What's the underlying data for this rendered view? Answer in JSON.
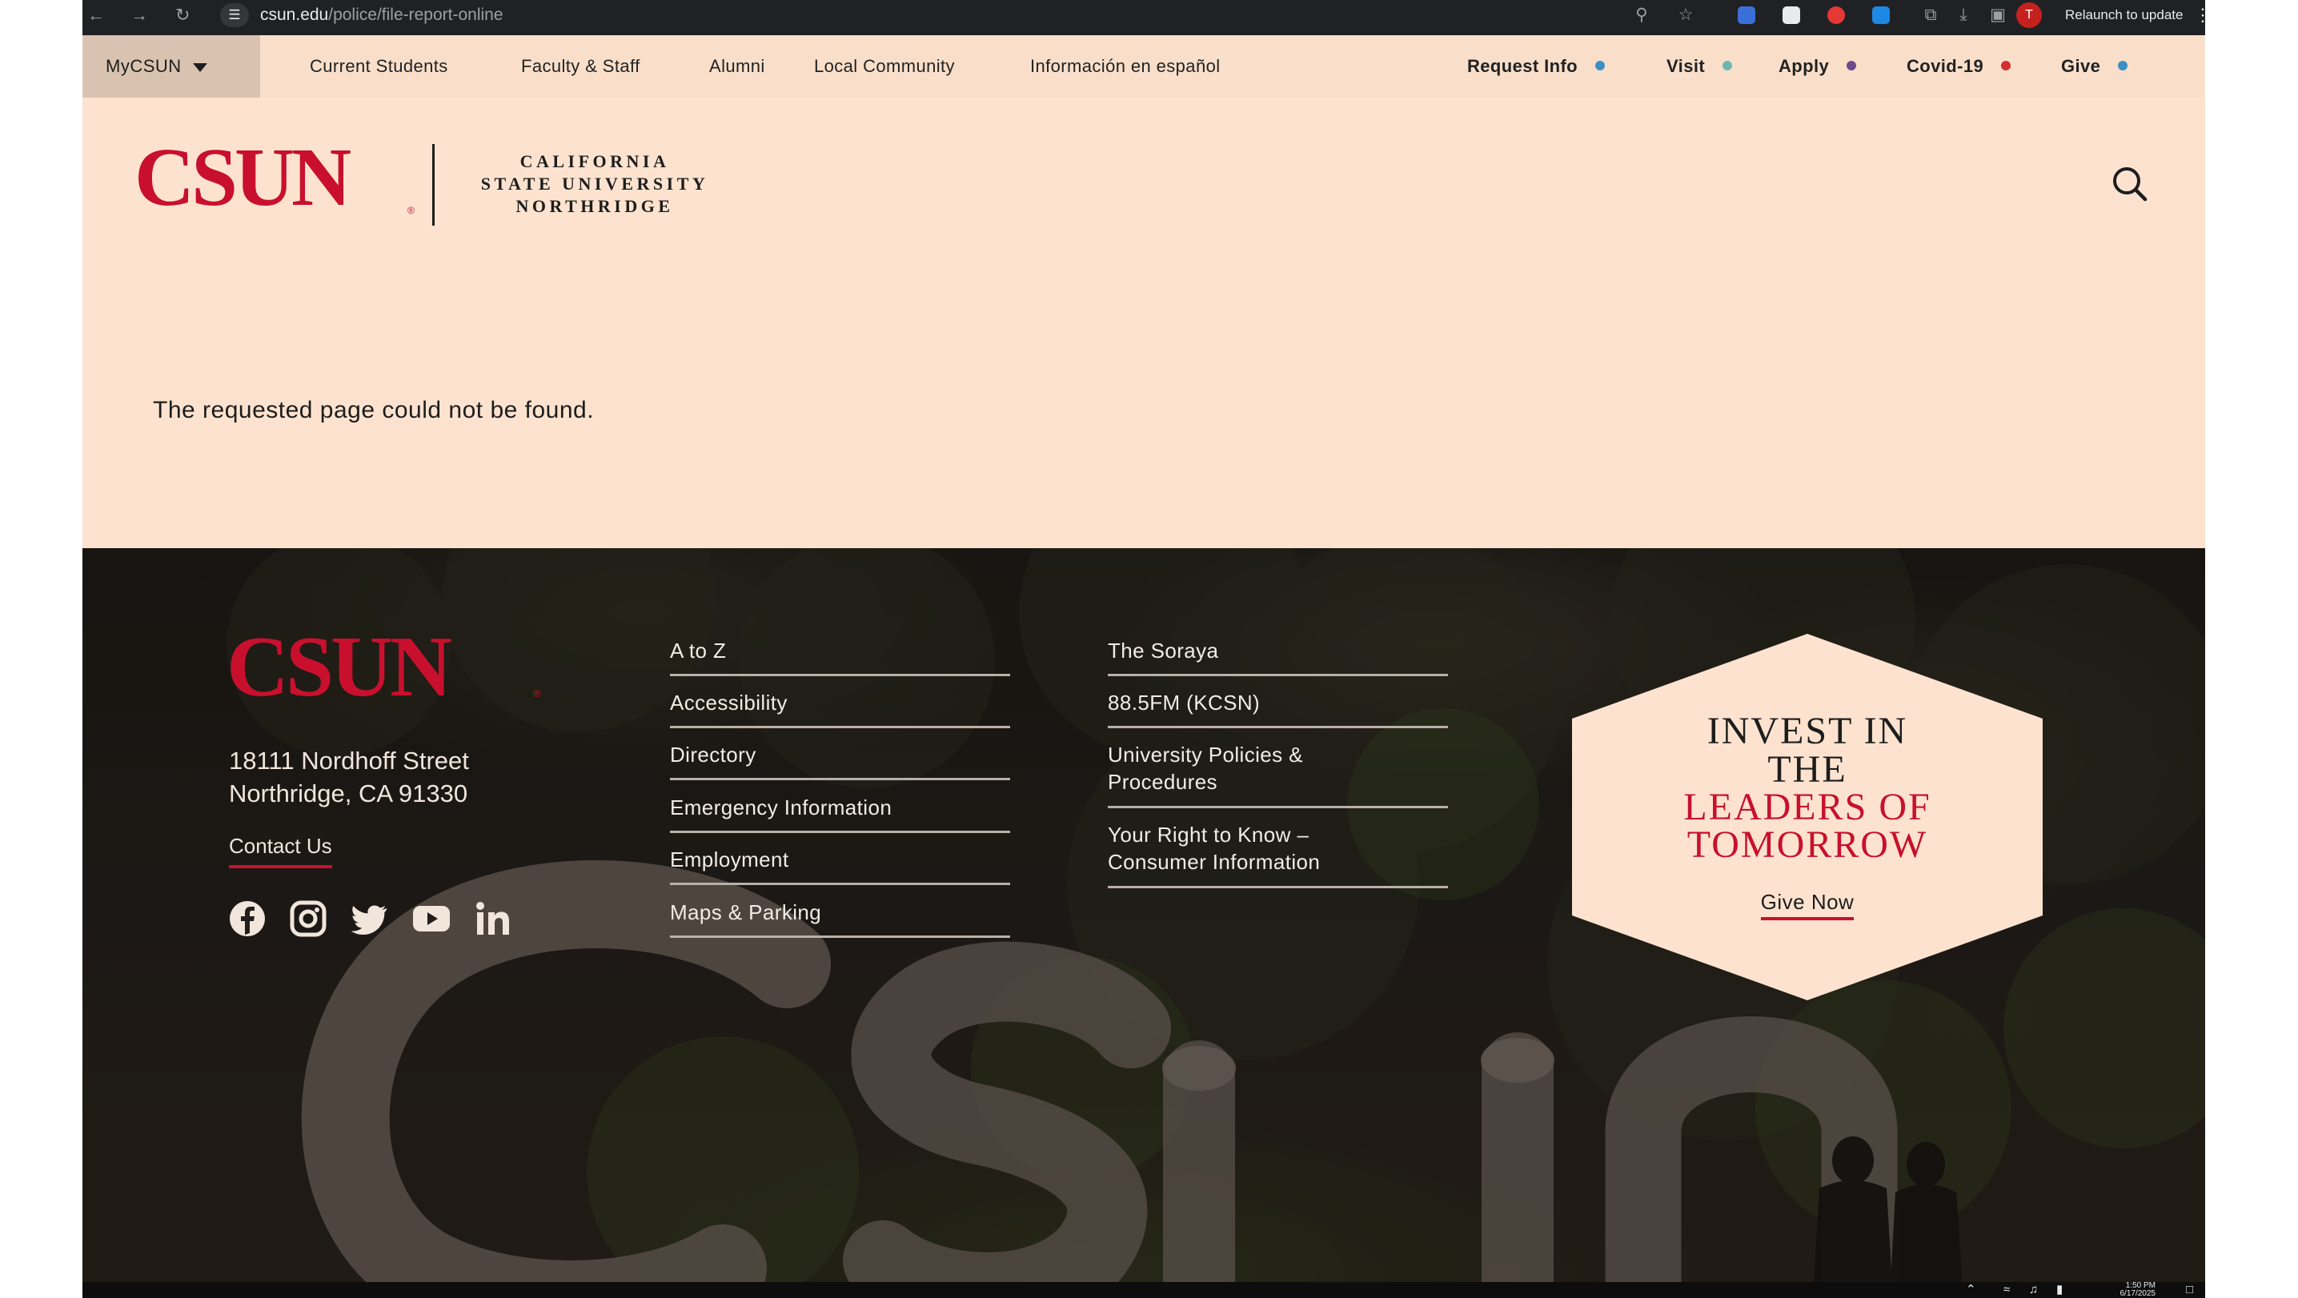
{
  "browser": {
    "back_icon": "arrow-left-icon",
    "forward_icon": "arrow-right-icon",
    "reload_icon": "reload-icon",
    "url_host": "csun.edu",
    "url_path": "/police/file-report-online",
    "zoom_icon": "zoom-icon",
    "bookmark_icon": "star-icon",
    "profile_initial": "T",
    "relaunch_label": "Relaunch to update"
  },
  "utility_nav": {
    "mycsun_label": "MyCSUN",
    "links": [
      "Current Students",
      "Faculty & Staff",
      "Alumni",
      "Local Community",
      "Información en español"
    ],
    "right_links": [
      {
        "label": "Request Info",
        "dot_color": "#3b8fc4"
      },
      {
        "label": "Visit",
        "dot_color": "#6bb7b0"
      },
      {
        "label": "Apply",
        "dot_color": "#6d4c8c"
      },
      {
        "label": "Covid-19",
        "dot_color": "#d32f2f"
      },
      {
        "label": "Give",
        "dot_color": "#3b8fc4"
      }
    ]
  },
  "header": {
    "logo_text": "CSUN",
    "logo_reg": "®",
    "logo_sub": [
      "CALIFORNIA",
      "STATE UNIVERSITY",
      "NORTHRIDGE"
    ],
    "search_icon": "search-icon"
  },
  "main": {
    "message": "The requested page could not be found."
  },
  "footer": {
    "logo_text": "CSUN",
    "logo_reg": "®",
    "address_line1": "18111 Nordhoff Street",
    "address_line2": "Northridge, CA 91330",
    "contact_label": "Contact Us",
    "social_icons": [
      "facebook-icon",
      "instagram-icon",
      "twitter-icon",
      "youtube-icon",
      "linkedin-icon"
    ],
    "column1": [
      "A to Z",
      "Accessibility",
      "Directory",
      "Emergency Information",
      "Employment",
      "Maps & Parking"
    ],
    "column2": [
      {
        "line1": "The Soraya",
        "line2": ""
      },
      {
        "line1": "88.5FM (KCSN)",
        "line2": ""
      },
      {
        "line1": "University Policies &",
        "line2": "Procedures"
      },
      {
        "line1": "Your Right to Know –",
        "line2": "Consumer Information"
      }
    ],
    "promo": {
      "line1": "INVEST IN",
      "line2": "THE",
      "line3": "LEADERS OF",
      "line4": "TOMORROW",
      "cta": "Give Now"
    }
  },
  "taskbar": {
    "time": "1:50 PM",
    "date": "6/17/2025"
  },
  "colors": {
    "brand_red": "#c8102e",
    "cream": "#fde3cf",
    "utility_bg": "#f9dfca"
  }
}
